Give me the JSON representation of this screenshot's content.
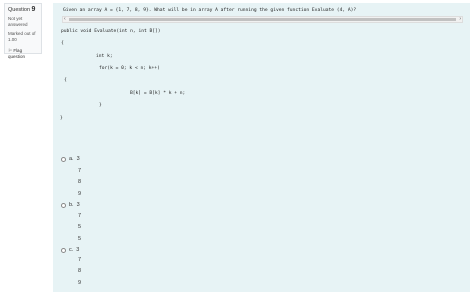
{
  "question_info": {
    "label": "Question",
    "number": "9",
    "status": [
      "Not yet",
      "answered"
    ],
    "marks": [
      "Marked out of",
      "1.00"
    ],
    "flag_label": "Flag question"
  },
  "question": {
    "text": "Given an array A = {1, 7, 8, 9}. What will be in array A after running the given function Evaluate (4, A)?",
    "code": [
      "public void Evaluate(int n, int B[])",
      "{",
      "int k;",
      "for(k = 0; k < n; k++)",
      "{",
      "B[k] = B[k] * k + n;",
      "}",
      "}"
    ]
  },
  "options": [
    {
      "letter": "a.",
      "values": [
        "3",
        "7",
        "8",
        "9"
      ]
    },
    {
      "letter": "b.",
      "values": [
        "3",
        "7",
        "5",
        "5"
      ]
    },
    {
      "letter": "c.",
      "values": [
        "3",
        "7",
        "8",
        "9"
      ]
    }
  ],
  "icons": {
    "flag": "flag-icon",
    "scroll_left": "chevron-left-icon",
    "scroll_right": "chevron-right-icon"
  }
}
